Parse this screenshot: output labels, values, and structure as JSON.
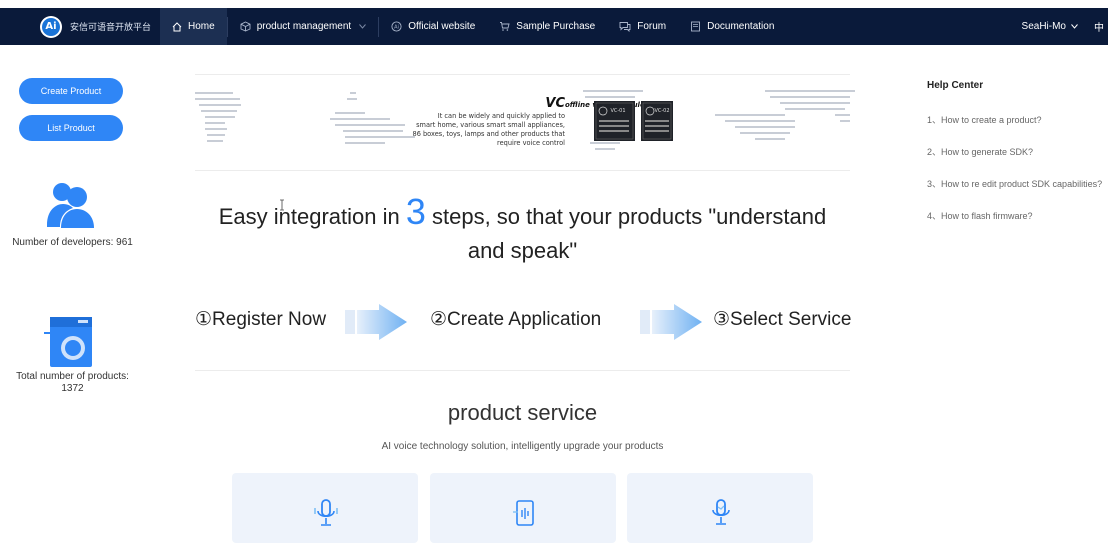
{
  "nav": {
    "logo_text": "安信可语音开放平台",
    "logo_mark": "Ai",
    "items": [
      {
        "label": "Home",
        "icon": "home-icon"
      },
      {
        "label": "product management",
        "icon": "cube-icon",
        "dropdown": true
      },
      {
        "label": "Official website",
        "icon": "ai-circle-icon"
      },
      {
        "label": "Sample Purchase",
        "icon": "cart-icon"
      },
      {
        "label": "Forum",
        "icon": "chat-icon"
      },
      {
        "label": "Documentation",
        "icon": "doc-icon"
      }
    ],
    "user": "SeaHi-Mo",
    "lang": "中"
  },
  "left": {
    "create_product": "Create Product",
    "list_product": "List Product",
    "developers_label": "Number of developers: 961",
    "products_label": "Total number of products:",
    "products_value": "1372"
  },
  "banner": {
    "title_vc": "VC",
    "title_rest": "offline voice module",
    "line1": "It can be widely and quickly applied to",
    "line2": "smart home, various smart small appliances,",
    "line3": "86 boxes, toys, lamps and other products that",
    "line4": "require voice control",
    "chip1": "VC-01",
    "chip2": "VC-02"
  },
  "headline": {
    "part1": "Easy integration in ",
    "num": "3",
    "part2": " steps, so that your products \"understand",
    "line2": "and speak\""
  },
  "steps": [
    "①Register Now",
    "②Create Application",
    "③Select Service"
  ],
  "service": {
    "title": "product service",
    "subtitle": "AI voice technology solution, intelligently upgrade your products"
  },
  "help": {
    "title": "Help Center",
    "items": [
      "1、How to create a product?",
      "2、How to generate SDK?",
      "3、How to re edit product SDK capabilities?",
      "4、How to flash firmware?"
    ]
  },
  "colors": {
    "accent": "#2f86f6",
    "nav_bg": "#0a1a3a"
  }
}
